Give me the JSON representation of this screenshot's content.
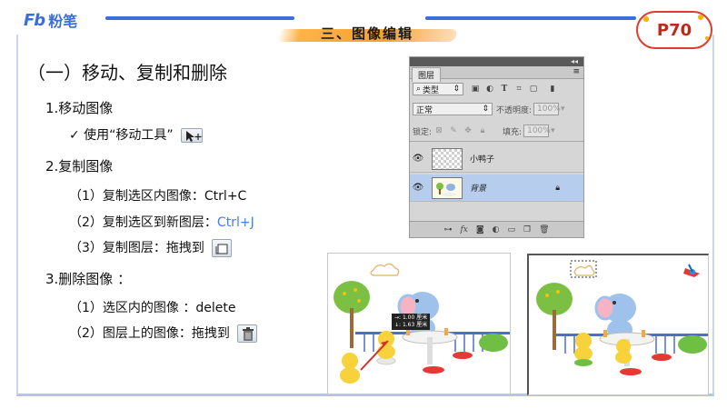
{
  "brand": {
    "mark": "Fb",
    "name": "粉笔"
  },
  "section_title": "三、图像编辑",
  "page_badge": "P70",
  "heading": "（一）移动、复制和删除",
  "items": {
    "move": {
      "title": "1.移动图像",
      "sub": "✓ 使用“移动工具”"
    },
    "copy": {
      "title": "2.复制图像",
      "sub1": "（1）复制选区内图像：Ctrl+C",
      "sub2_prefix": "（2）复制选区到新图层：",
      "sub2_key": "Ctrl+J",
      "sub3": "（3）复制图层：拖拽到"
    },
    "delete": {
      "title": "3.删除图像 ：",
      "sub1": "（1）选区内的图像 ：delete",
      "sub2": "（2）图层上的图像：拖拽到"
    }
  },
  "layers_panel": {
    "tab": "图层",
    "filter_kind": "类型",
    "blend_mode": "正常",
    "opacity_label": "不透明度:",
    "opacity_value": "100%",
    "lock_label": "锁定:",
    "fill_label": "填充:",
    "fill_value": "100%",
    "layers": [
      {
        "name": "小鸭子",
        "selected": false,
        "locked": false
      },
      {
        "name": "背景",
        "selected": true,
        "locked": true
      }
    ],
    "footer_icons": [
      "link-icon",
      "fx-icon",
      "mask-icon",
      "adjustment-icon",
      "group-icon",
      "new-layer-icon",
      "trash-icon"
    ]
  },
  "tooltip": {
    "line1": "→: 1.00 厘米",
    "line2": "↓: 1.63 厘米"
  },
  "colors": {
    "accent": "#3b6fd8",
    "badge": "#e23a2c",
    "link": "#3b82f6",
    "layer_selected": "#b7cdee"
  }
}
